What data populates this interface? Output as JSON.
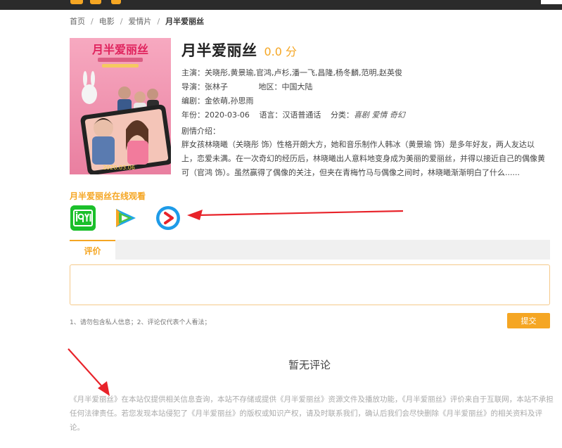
{
  "breadcrumb": {
    "home": "首页",
    "movie": "电影",
    "genre": "爱情片",
    "current": "月半爱丽丝"
  },
  "movie": {
    "title": "月半爱丽丝",
    "score": "0.0 分",
    "poster_title": "月半爱丽丝",
    "poster_date": "2020.03.06",
    "cast_label": "主演：",
    "cast": "关晓彤,黄景瑜,官鸿,卢杉,潘一飞,昌隆,杨冬麟,范明,赵英俊",
    "director_label": "导演：",
    "director": "张林子",
    "region_label": "地区：",
    "region": "中国大陆",
    "writer_label": "编剧：",
    "writer": "金依萌,孙思雨",
    "year_label": "年份：",
    "year": "2020-03-06",
    "language_label": "语言：",
    "language": "汉语普通话",
    "category_label": "分类：",
    "category": "喜剧 爱情 奇幻",
    "intro_label": "剧情介绍：",
    "intro": "胖女孩林晓曦（关晓彤 饰）性格开朗大方，她和音乐制作人韩冰（黄景瑜 饰）是多年好友，两人友达以上，恋爱未满。在一次奇幻的经历后，林晓曦出人意料地变身成为美丽的爱丽丝，并得以接近自己的偶像黄可（官鸿 饰）。虽然赢得了偶像的关注，但夹在青梅竹马与偶像之间时，林晓曦渐渐明白了什么......"
  },
  "watch": {
    "title": "月半爱丽丝在线观看",
    "platforms": [
      "iqiyi-icon",
      "tencent-video-icon",
      "youku-icon"
    ]
  },
  "comments": {
    "tab_label": "评价",
    "input_placeholder": "",
    "tip": "1、请勿包含私人信息；2、评论仅代表个人看法；",
    "submit_label": "提交",
    "empty_text": "暂无评论"
  },
  "disclaimer": "《月半爱丽丝》在本站仅提供相关信息查询，本站不存储或提供《月半爱丽丝》资源文件及播放功能，《月半爱丽丝》评价来自于互联网，本站不承担任何法律责任。若您发现本站侵犯了《月半爱丽丝》的版权或知识产权，请及时联系我们，确认后我们会尽快删除《月半爱丽丝》的相关资料及评论。",
  "colors": {
    "accent": "#f5a623",
    "annotation_red": "#e8232a",
    "iqiyi_green": "#1bbf2b",
    "youku_blue": "#1e9be8"
  }
}
